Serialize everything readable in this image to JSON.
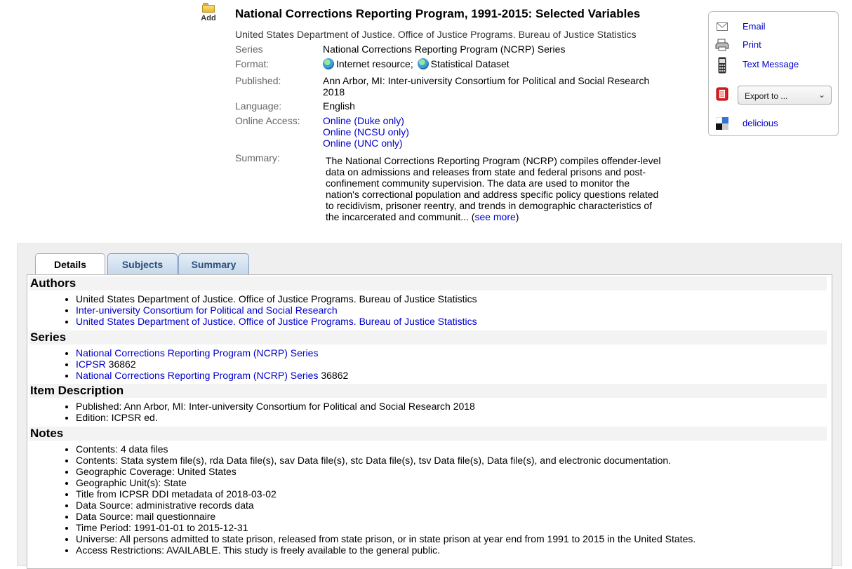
{
  "add_label": "Add",
  "record": {
    "title": "National Corrections Reporting Program, 1991-2015: Selected Variables",
    "author": "United States Department of Justice. Office of Justice Programs. Bureau of Justice Statistics",
    "series_label": "Series",
    "series_value": "National Corrections Reporting Program (NCRP) Series",
    "format_label": "Format:",
    "format_values": [
      "Internet resource;",
      "Statistical Dataset"
    ],
    "published_label": "Published:",
    "published_value": "Ann Arbor, MI: Inter-university Consortium for Political and Social Research 2018",
    "language_label": "Language:",
    "language_value": "English",
    "online_label": "Online Access:",
    "online_links": [
      "Online (Duke only)",
      "Online (NCSU only)",
      "Online (UNC only)"
    ],
    "summary_label": "Summary:",
    "summary_text": "The National Corrections Reporting Program (NCRP) compiles offender-level data on admissions and releases from state and federal prisons and post-confinement community supervision. The data are used to monitor the nation's correctional population and address specific policy questions related to recidivism, prisoner reentry, and trends in demographic characteristics of the incarcerated and communit... (",
    "see_more": "see more",
    "summary_close": ")"
  },
  "tools": {
    "email": "Email",
    "print": "Print",
    "text_message": "Text Message",
    "export": "Export to ...",
    "delicious": "delicious"
  },
  "tabs": [
    "Details",
    "Subjects",
    "Summary"
  ],
  "details": {
    "authors_head": "Authors",
    "authors": [
      "United States Department of Justice. Office of Justice Programs. Bureau of Justice Statistics",
      "Inter-university Consortium for Political and Social Research",
      "United States Department of Justice. Office of Justice Programs. Bureau of Justice Statistics"
    ],
    "series_head": "Series",
    "series": [
      {
        "link": "National Corrections Reporting Program (NCRP) Series",
        "suffix": ""
      },
      {
        "link": "ICPSR",
        "suffix": " 36862"
      },
      {
        "link": "National Corrections Reporting Program (NCRP) Series",
        "suffix": " 36862"
      }
    ],
    "item_head": "Item Description",
    "item": [
      "Published: Ann Arbor, MI: Inter-university Consortium for Political and Social Research 2018",
      "Edition: ICPSR ed."
    ],
    "notes_head": "Notes",
    "notes": [
      "Contents: 4 data files",
      "Contents: Stata system file(s), rda Data file(s), sav Data file(s), stc Data file(s), tsv Data file(s), Data file(s), and electronic documentation.",
      "Geographic Coverage: United States",
      "Geographic Unit(s): State",
      "Title from ICPSR DDI metadata of 2018-03-02",
      "Data Source: administrative records data",
      "Data Source: mail questionnaire",
      "Time Period: 1991-01-01 to 2015-12-31",
      "Universe: All persons admitted to state prison, released from state prison, or in state prison at year end from 1991 to 2015 in the United States.",
      "Access Restrictions: AVAILABLE. This study is freely available to the general public."
    ]
  }
}
